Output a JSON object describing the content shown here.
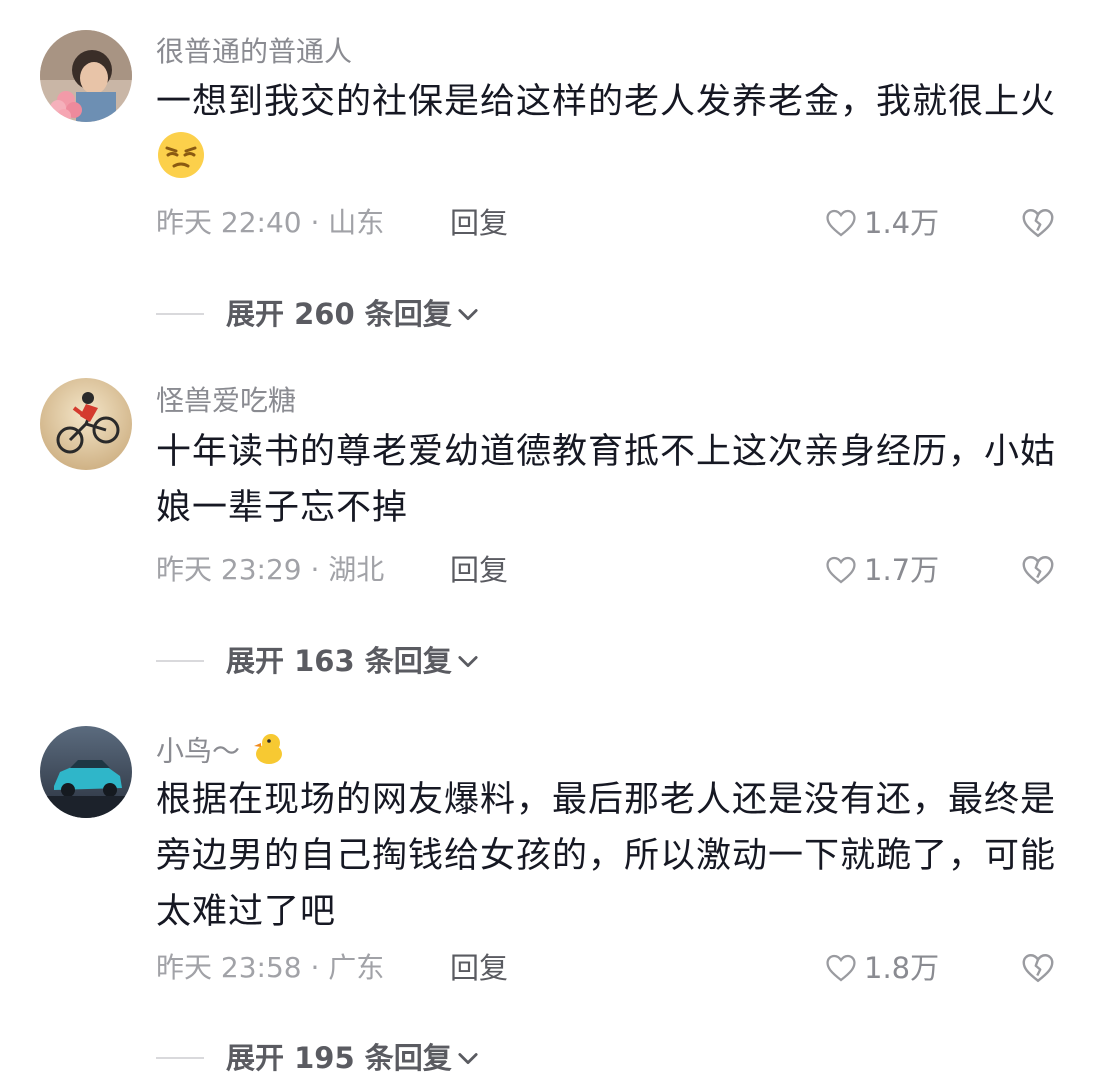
{
  "comments": [
    {
      "username": "很普通的普通人",
      "text": "一想到我交的社保是给这样的老人发养老金，我就很上火",
      "emoji": "squinting-face-emoji",
      "time": "昨天 22:40 · 山东",
      "reply_label": "回复",
      "likes": "1.4万",
      "expand_label": "展开 260 条回复"
    },
    {
      "username": "怪兽爱吃糖",
      "text": "十年读书的尊老爱幼道德教育抵不上这次亲身经历，小姑娘一辈子忘不掉",
      "time": "昨天 23:29 · 湖北",
      "reply_label": "回复",
      "likes": "1.7万",
      "expand_label": "展开 163 条回复"
    },
    {
      "username": "小鸟～",
      "username_emoji": "duckling-emoji",
      "text": "根据在现场的网友爆料，最后那老人还是没有还，最终是旁边男的自己掏钱给女孩的，所以激动一下就跪了，可能太难过了吧",
      "time": "昨天 23:58 · 广东",
      "reply_label": "回复",
      "likes": "1.8万",
      "expand_label": "展开 195 条回复"
    }
  ],
  "colors": {
    "text_primary": "#161823",
    "text_secondary": "#8a8b91",
    "text_tertiary": "#a1a2a7"
  }
}
